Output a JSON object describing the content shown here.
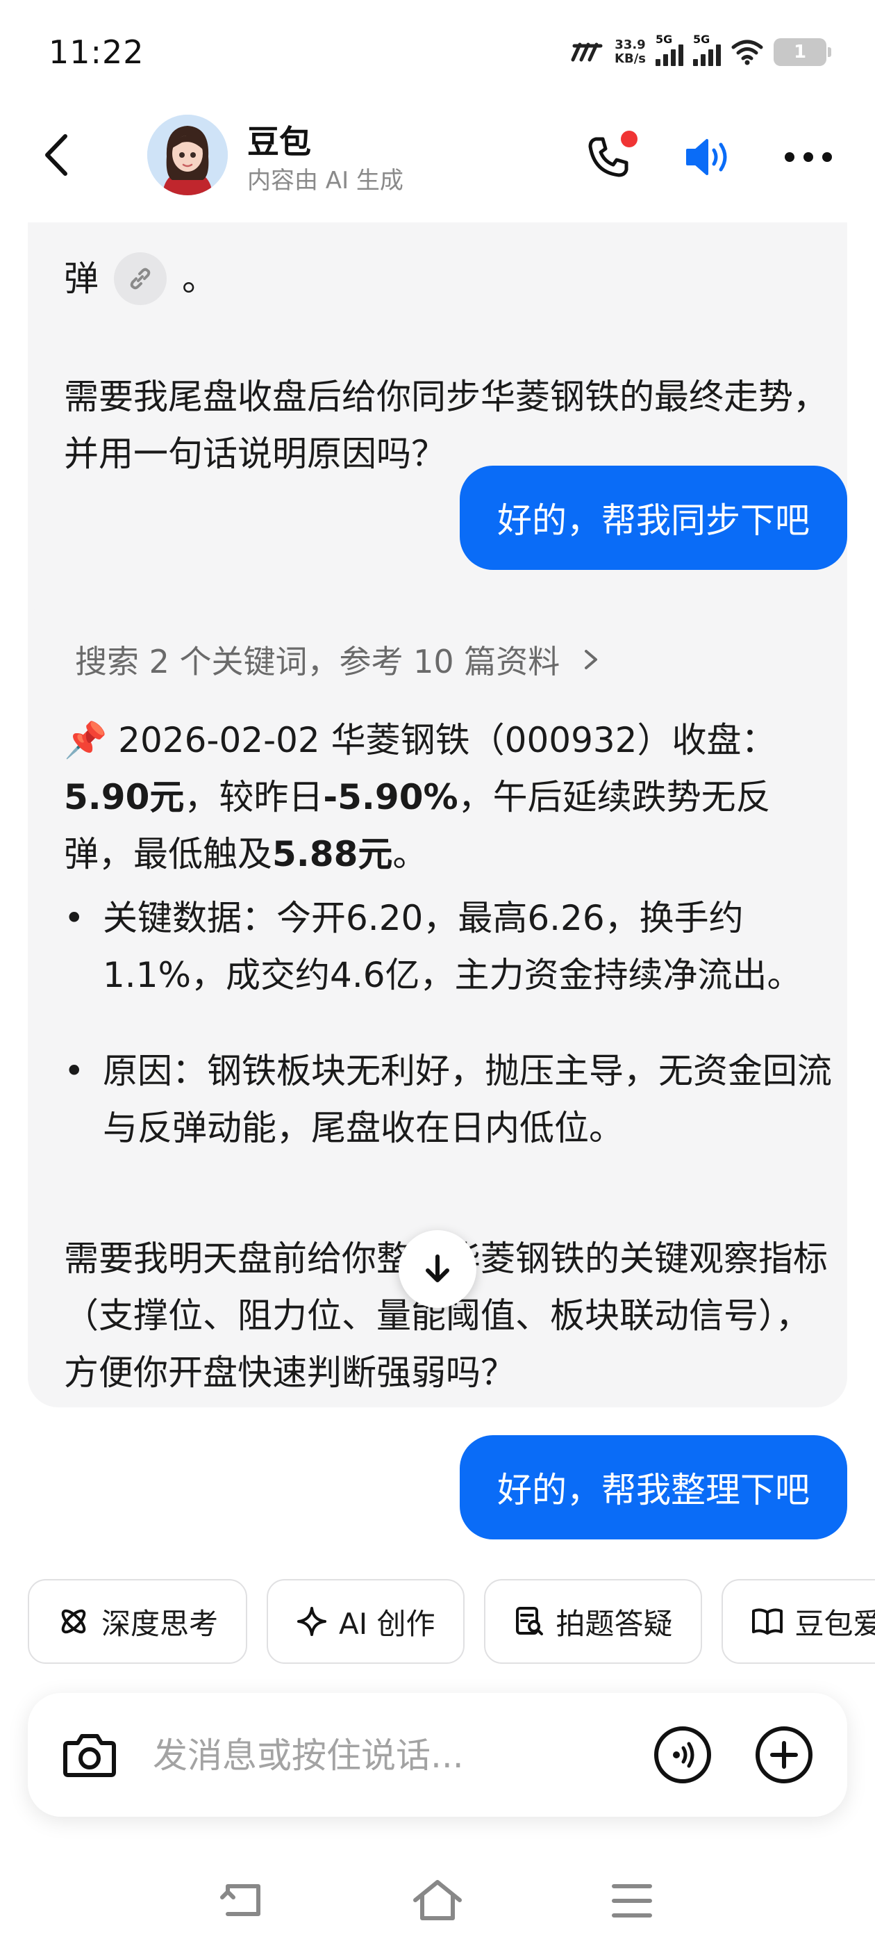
{
  "status": {
    "time": "11:22",
    "speed_value": "33.9",
    "speed_unit": "KB/s",
    "sim1": "5G",
    "sim2": "5G",
    "battery": "1"
  },
  "header": {
    "title": "豆包",
    "subtitle": "内容由 AI 生成"
  },
  "messages": {
    "ai1": {
      "partial_char": "弹",
      "partial_end": "。",
      "paragraph": "需要我尾盘收盘后给你同步华菱钢铁的最终走势，并用一句话说明原因吗？"
    },
    "user1": "好的，帮我同步下吧",
    "ai2": {
      "search_summary": "搜索 2 个关键词，参考 10 篇资料",
      "pin_emoji": "📌",
      "p1_a": " 2026-02-02 华菱钢铁（000932）收盘：",
      "p1_price": "5.90元",
      "p1_b": "，较昨日",
      "p1_change": "-5.90%",
      "p1_c": "，午后延续跌势无反弹，最低触及",
      "p1_low": "5.88元",
      "p1_d": "。",
      "bullet1": "关键数据：今开6.20，最高6.26，换手约1.1%，成交约4.6亿，主力资金持续净流出。",
      "bullet2": "原因：钢铁板块无利好，抛压主导，无资金回流与反弹动能，尾盘收在日内低位。",
      "p2": "需要我明天盘前给你整理华菱钢铁的关键观察指标（支撑位、阻力位、量能阈值、板块联动信号），方便你开盘快速判断强弱吗？"
    },
    "user2": "好的，帮我整理下吧"
  },
  "chips": [
    "深度思考",
    "AI 创作",
    "拍题答疑",
    "豆包爱"
  ],
  "input": {
    "placeholder": "发消息或按住说话..."
  },
  "colors": {
    "accent": "#0a6cf7",
    "bubble_bg": "#f5f5f6",
    "notify_dot": "#f03434"
  },
  "icons": [
    "back-arrow-icon",
    "phone-icon",
    "speaker-icon",
    "more-icon",
    "link-icon",
    "chevron-right-icon",
    "arrow-down-icon",
    "atom-icon",
    "sparkle-icon",
    "scan-question-icon",
    "book-icon",
    "camera-icon",
    "voice-icon",
    "plus-icon",
    "nav-back-icon",
    "nav-home-icon",
    "nav-menu-icon"
  ]
}
